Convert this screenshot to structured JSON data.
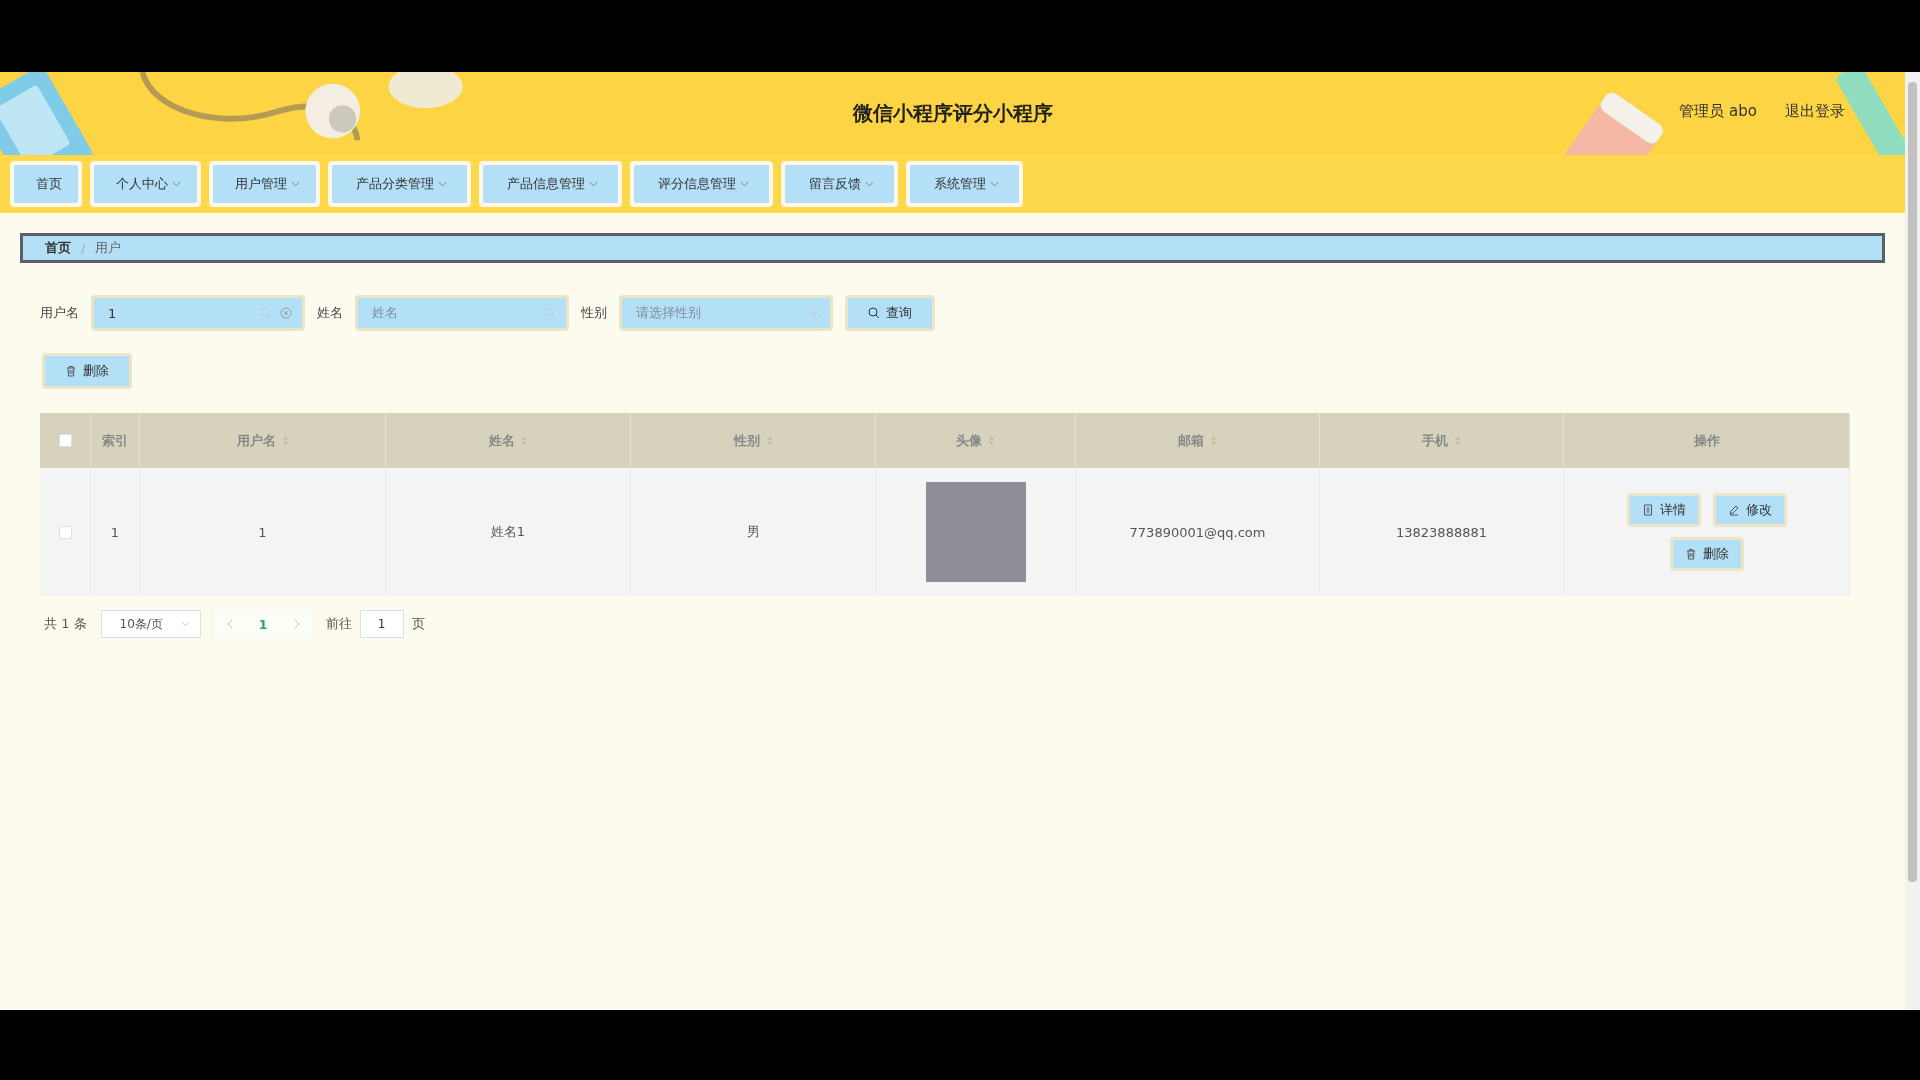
{
  "header": {
    "title": "微信小程序评分小程序",
    "user": "管理员 abo",
    "logout": "退出登录"
  },
  "nav": [
    {
      "label": "首页",
      "dropdown": false
    },
    {
      "label": "个人中心",
      "dropdown": true
    },
    {
      "label": "用户管理",
      "dropdown": true
    },
    {
      "label": "产品分类管理",
      "dropdown": true
    },
    {
      "label": "产品信息管理",
      "dropdown": true
    },
    {
      "label": "评分信息管理",
      "dropdown": true
    },
    {
      "label": "留言反馈",
      "dropdown": true
    },
    {
      "label": "系统管理",
      "dropdown": true
    }
  ],
  "breadcrumb_separator": "/",
  "breadcrumb": [
    {
      "label": "首页",
      "current": false
    },
    {
      "label": "用户",
      "current": true
    }
  ],
  "filters": [
    {
      "kind": "text",
      "label": "用户名",
      "value": "1",
      "clearable": true
    },
    {
      "kind": "text",
      "label": "姓名",
      "placeholder": "姓名",
      "clearable": false
    },
    {
      "kind": "select",
      "label": "性别",
      "placeholder": "请选择性别",
      "clearable": false
    }
  ],
  "search_button": "查询",
  "delete_button": "删除",
  "table": {
    "columns": [
      {
        "label": "索引",
        "sortable": false
      },
      {
        "label": "用户名",
        "sortable": true
      },
      {
        "label": "姓名",
        "sortable": true
      },
      {
        "label": "性别",
        "sortable": true
      },
      {
        "label": "头像",
        "sortable": true
      },
      {
        "label": "邮箱",
        "sortable": true
      },
      {
        "label": "手机",
        "sortable": true
      },
      {
        "label": "操作",
        "sortable": false
      }
    ],
    "all_checked": false,
    "rows": [
      {
        "checked": false,
        "cells": [
          {
            "kind": "text",
            "text": "1"
          },
          {
            "kind": "text",
            "text": "1"
          },
          {
            "kind": "text",
            "text": "姓名1"
          },
          {
            "kind": "text",
            "text": "男"
          },
          {
            "kind": "photo"
          },
          {
            "kind": "text",
            "text": "773890001@qq.com"
          },
          {
            "kind": "text",
            "text": "13823888881"
          }
        ],
        "actions": [
          {
            "kind": "detail",
            "label": "详情"
          },
          {
            "kind": "edit",
            "label": "修改"
          },
          {
            "kind": "delete",
            "label": "删除"
          }
        ]
      }
    ]
  },
  "pagination": {
    "total": "共 1 条",
    "page_size": "10条/页",
    "pages": [
      {
        "label": "1",
        "selected": true
      }
    ],
    "goto_label": "前往",
    "goto_value": "1",
    "page_suffix": "页"
  }
}
